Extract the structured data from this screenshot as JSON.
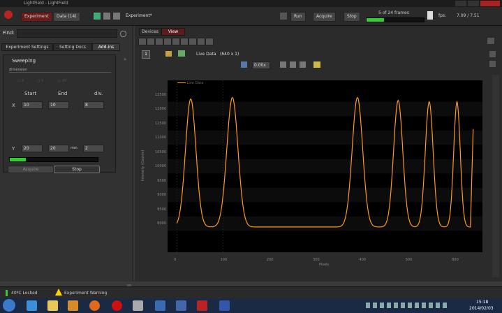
{
  "titlebar": {
    "title": "LightField - LightField"
  },
  "toolbar": {
    "experiment_label": "Experiment",
    "data_label": "Data (14)",
    "experiment_name": "Experiment*",
    "run_label": "Run",
    "acquire_label": "Acquire",
    "stop_label": "Stop",
    "frames_status": "5 of 24 frames",
    "fps_label": "fps:",
    "fps_value": "7.09 / 7.51",
    "progress_fraction": 0.3
  },
  "left_panel": {
    "find_label": "Find:",
    "tabs": [
      "Experiment Settings",
      "Setting Docs",
      "Add-ins"
    ],
    "active_tab_index": 2,
    "sweep": {
      "title": "Sweeping",
      "sublabel": "dimension",
      "axes": [
        "X",
        "Y",
        "XY"
      ],
      "col_headers": [
        "Start",
        "End",
        "div."
      ],
      "rows": [
        {
          "label": "X",
          "start": "10",
          "end": "10",
          "div": "8",
          "unit": ""
        },
        {
          "label": "Y",
          "start": "20",
          "end": "20",
          "div": "2",
          "unit": "mm"
        }
      ],
      "progress_fraction": 0.18,
      "acquire_label": "Acquire",
      "stop_label": "Stop"
    }
  },
  "right_panel": {
    "tabs": [
      "Devices",
      "View"
    ],
    "active_tab_index": 1,
    "view_label": "Live Data",
    "view_dims": "(640 x 1)",
    "zoom_label": "0.00x"
  },
  "chart_data": {
    "type": "line",
    "legend": "Live Data",
    "xlabel": "Pixels",
    "ylabel": "Intensity (Counts)",
    "xlim": [
      -20,
      660
    ],
    "ylim": [
      7000,
      13000
    ],
    "x_ticks": [
      0,
      100,
      200,
      300,
      400,
      500,
      600
    ],
    "y_ticks": [
      8000,
      8500,
      9000,
      9500,
      10000,
      10500,
      11000,
      11500,
      12000,
      12500
    ],
    "y_tick_labels": [
      "8000",
      "8500",
      "9000",
      "9500",
      "10000",
      "10500",
      "11000",
      "11500",
      "12000",
      "12500"
    ],
    "peaks": [
      {
        "x": 30,
        "y": 12350,
        "w": 16
      },
      {
        "x": 120,
        "y": 12400,
        "w": 17
      },
      {
        "x": 390,
        "y": 12400,
        "w": 16
      },
      {
        "x": 478,
        "y": 12300,
        "w": 14
      },
      {
        "x": 545,
        "y": 12250,
        "w": 12
      },
      {
        "x": 605,
        "y": 12250,
        "w": 10
      }
    ],
    "baseline": 7880,
    "x_end": 640,
    "y_end": 11300,
    "color": "#ff9a1a"
  },
  "statusbar": {
    "item1": "40ºC Locked",
    "item2": "Experiment Warning"
  },
  "taskbar": {
    "time": "15:18",
    "date": "2014/02/03"
  }
}
